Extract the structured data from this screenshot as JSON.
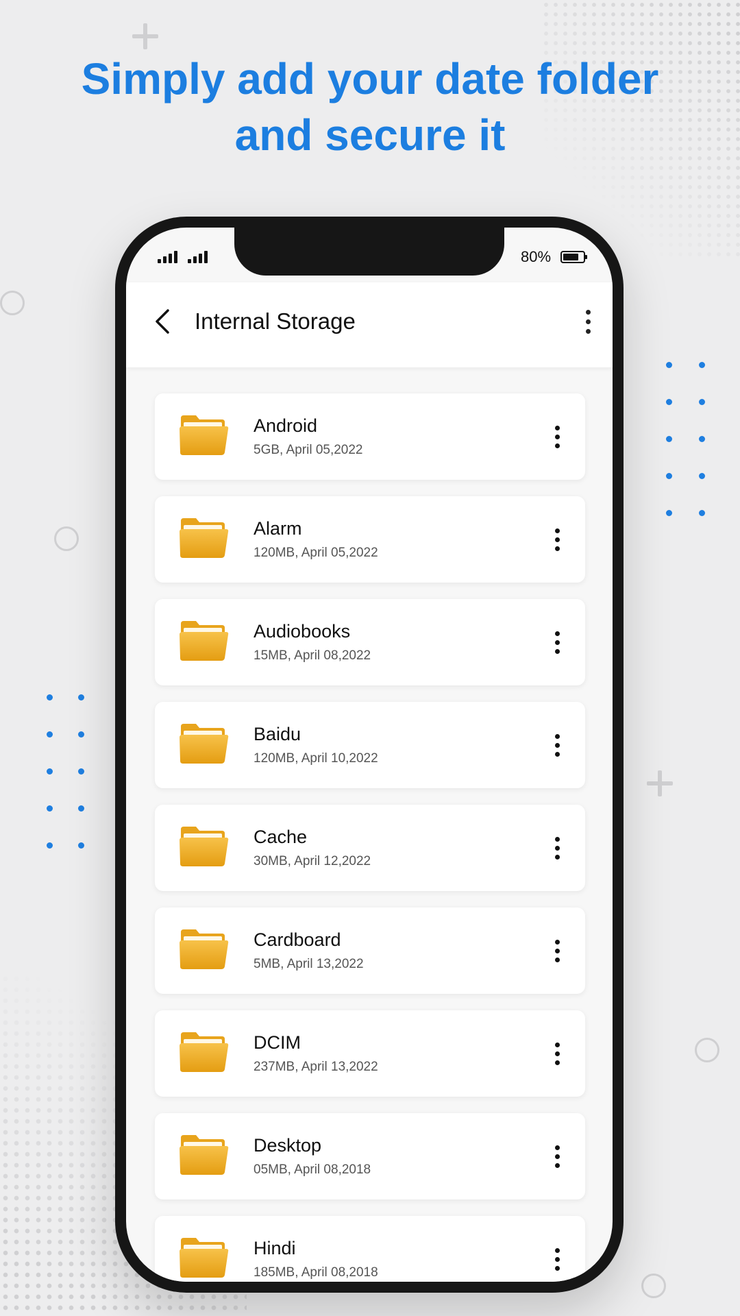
{
  "headline": {
    "line1": "Simply add your date folder",
    "line2": "and secure it"
  },
  "status_bar": {
    "battery_text": "80%",
    "battery_level": 0.8
  },
  "app_bar": {
    "title": "Internal Storage",
    "back_icon": "chevron-left-icon",
    "menu_icon": "more-vertical-icon"
  },
  "colors": {
    "accent": "#1c7ee0",
    "folder": "#f0b22a",
    "background": "#ededee"
  },
  "folders": [
    {
      "name": "Android",
      "meta": "5GB, April 05,2022"
    },
    {
      "name": "Alarm",
      "meta": "120MB, April 05,2022"
    },
    {
      "name": "Audiobooks",
      "meta": "15MB, April 08,2022"
    },
    {
      "name": "Baidu",
      "meta": "120MB, April 10,2022"
    },
    {
      "name": "Cache",
      "meta": "30MB, April 12,2022"
    },
    {
      "name": "Cardboard",
      "meta": "5MB, April 13,2022"
    },
    {
      "name": "DCIM",
      "meta": "237MB, April 13,2022"
    },
    {
      "name": "Desktop",
      "meta": "05MB, April 08,2018"
    },
    {
      "name": "Hindi",
      "meta": "185MB, April 08,2018"
    }
  ]
}
